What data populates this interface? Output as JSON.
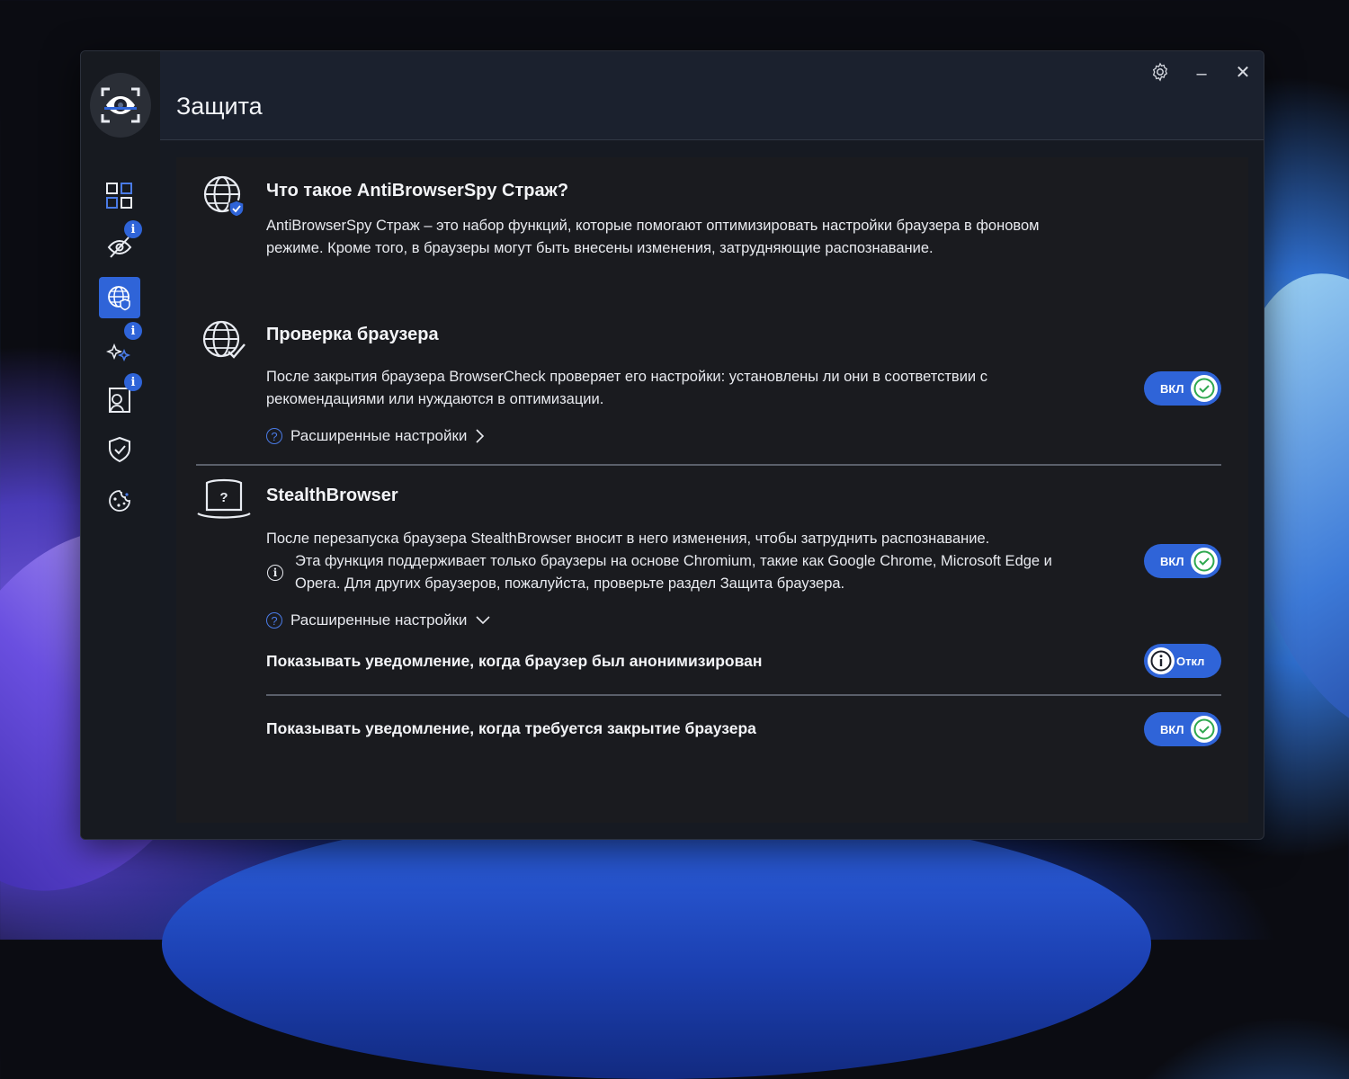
{
  "window": {
    "title": "Защита",
    "controls": {
      "settings_icon": "gear-icon",
      "minimize": "–",
      "close": "✕"
    }
  },
  "sidebar": {
    "items": [
      {
        "name": "dashboard",
        "icon": "grid-icon",
        "badge": ""
      },
      {
        "name": "privacy",
        "icon": "eye-slash-icon",
        "badge": "i"
      },
      {
        "name": "protection",
        "icon": "globe-shield-icon",
        "badge": "",
        "active": true
      },
      {
        "name": "optimization",
        "icon": "sparkle-icon",
        "badge": "i"
      },
      {
        "name": "identity",
        "icon": "id-card-icon",
        "badge": "i"
      },
      {
        "name": "security",
        "icon": "shield-check-icon",
        "badge": ""
      },
      {
        "name": "cookies",
        "icon": "cookie-icon",
        "badge": ""
      }
    ]
  },
  "intro": {
    "title": "Что такое AntiBrowserSpy Страж?",
    "text_line1": "AntiBrowserSpy Страж – это набор функций, которые помогают оптимизировать настройки браузера в фоновом",
    "text_line2": "режиме. Кроме того, в браузеры могут быть внесены изменения, затрудняющие распознавание."
  },
  "browser_check": {
    "title": "Проверка браузера",
    "text_line1": "После закрытия браузера BrowserCheck проверяет его настройки: установлены ли они в соответствии с",
    "text_line2": "рекомендациями или нуждаются в оптимизации.",
    "advanced": "Расширенные настройки",
    "toggle_label": "ВКЛ",
    "toggle_state": "on"
  },
  "stealth": {
    "title": "StealthBrowser",
    "text": "После перезапуска браузера StealthBrowser вносит в него изменения, чтобы затруднить распознавание.",
    "info_line1": "Эта функция поддерживает только браузеры на основе Chromium, такие как Google Chrome, Microsoft Edge и",
    "info_line2": "Opera. Для других браузеров, пожалуйста, проверьте раздел Защита браузера.",
    "advanced": "Расширенные настройки",
    "toggle_label": "ВКЛ",
    "toggle_state": "on"
  },
  "notify_anon": {
    "label": "Показывать уведомление, когда браузер был анонимизирован",
    "toggle_label": "Откл",
    "toggle_state": "off"
  },
  "notify_close": {
    "label": "Показывать уведомление, когда требуется закрытие браузера",
    "toggle_label": "ВКЛ",
    "toggle_state": "on"
  },
  "colors": {
    "accent": "#2f64d8",
    "check": "#2fa84f",
    "panel": "#1a1b1f"
  }
}
